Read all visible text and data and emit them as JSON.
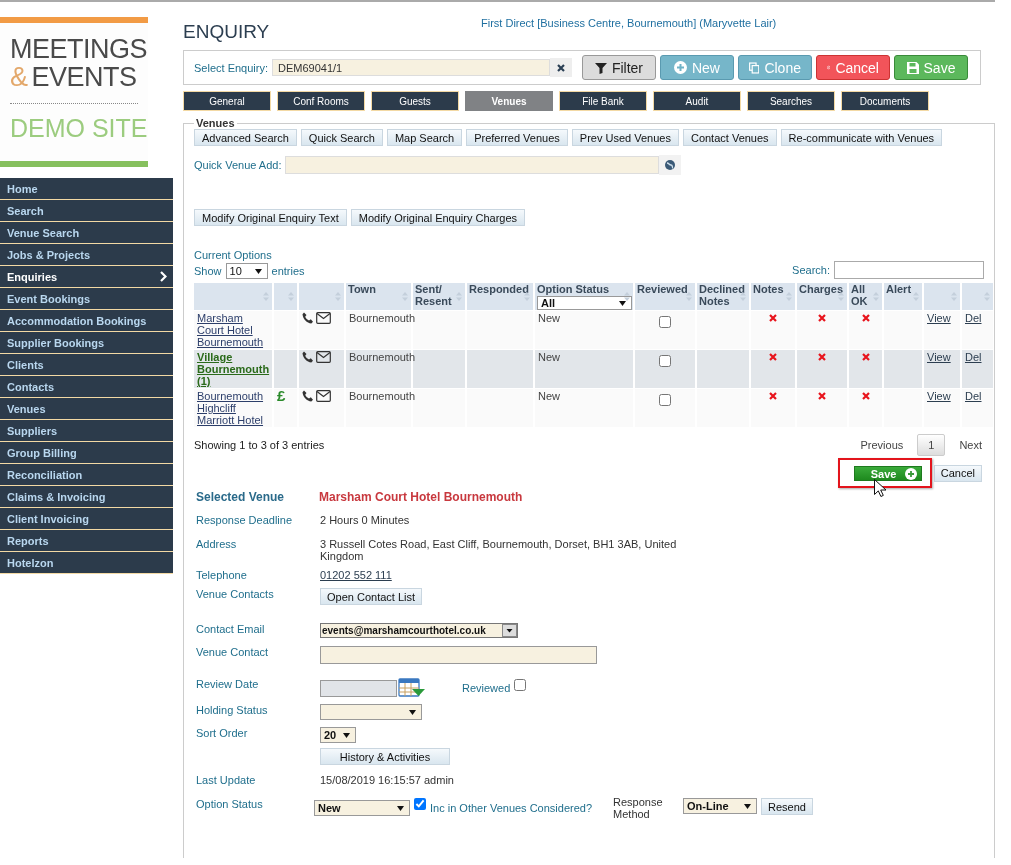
{
  "logo": {
    "line_1": "MEETINGS",
    "ampersand": "&",
    "line_2": "EVENTS",
    "line_3": "DEMO SITE"
  },
  "sidebar": {
    "items": [
      {
        "label": "Home",
        "selected": false
      },
      {
        "label": "Search",
        "selected": false
      },
      {
        "label": "Venue Search",
        "selected": false
      },
      {
        "label": "Jobs & Projects",
        "selected": false
      },
      {
        "label": "Enquiries",
        "selected": true
      },
      {
        "label": "Event Bookings",
        "selected": false
      },
      {
        "label": "Accommodation Bookings",
        "selected": false
      },
      {
        "label": "Supplier Bookings",
        "selected": false
      },
      {
        "label": "Clients",
        "selected": false
      },
      {
        "label": "Contacts",
        "selected": false
      },
      {
        "label": "Venues",
        "selected": false
      },
      {
        "label": "Suppliers",
        "selected": false
      },
      {
        "label": "Group Billing",
        "selected": false
      },
      {
        "label": "Reconciliation",
        "selected": false
      },
      {
        "label": "Claims & Invoicing",
        "selected": false
      },
      {
        "label": "Client Invoicing",
        "selected": false
      },
      {
        "label": "Reports",
        "selected": false
      },
      {
        "label": "Hotelzon",
        "selected": false
      }
    ]
  },
  "page_title": "ENQUIRY",
  "context": "First Direct [Business Centre, Bournemouth] (Maryvette Lair)",
  "enquiry_bar": {
    "label": "Select Enquiry:",
    "value": "DEM69041/1",
    "buttons": [
      {
        "label": "Filter",
        "kind": "filter"
      },
      {
        "label": "New",
        "kind": "new"
      },
      {
        "label": "Clone",
        "kind": "clone"
      },
      {
        "label": "Cancel",
        "kind": "cancel"
      },
      {
        "label": "Save",
        "kind": "save"
      }
    ]
  },
  "tabs": [
    {
      "label": "General",
      "selected": false
    },
    {
      "label": "Conf Rooms",
      "selected": false
    },
    {
      "label": "Guests",
      "selected": false
    },
    {
      "label": "Venues",
      "selected": true
    },
    {
      "label": "File Bank",
      "selected": false
    },
    {
      "label": "Audit",
      "selected": false
    },
    {
      "label": "Searches",
      "selected": false
    },
    {
      "label": "Documents",
      "selected": false
    }
  ],
  "venues": {
    "legend": "Venues",
    "search_buttons": [
      "Advanced Search",
      "Quick Search",
      "Map Search",
      "Preferred Venues",
      "Prev Used Venues",
      "Contact Venues",
      "Re-communicate with Venues"
    ],
    "quick_add_label": "Quick Venue Add:",
    "modify_buttons": [
      "Modify Original Enquiry Text",
      "Modify Original Enquiry Charges"
    ],
    "options": {
      "title": "Current Options",
      "show": "Show",
      "page_length": "10",
      "entries": "entries",
      "search_label": "Search:",
      "columns": [
        {},
        {},
        {},
        {
          "label": "Town"
        },
        {
          "label": "Sent/ Resent"
        },
        {
          "label": "Responded"
        },
        {
          "label": "Option Status",
          "filter": "All"
        },
        {
          "label": "Reviewed"
        },
        {
          "label": "Declined Notes"
        },
        {
          "label": "Notes"
        },
        {
          "label": "Charges"
        },
        {
          "label": "All OK"
        },
        {
          "label": "Alert"
        },
        {},
        {}
      ],
      "rows": [
        {
          "venue": "Marsham Court Hotel Bournemouth",
          "highlighted": false,
          "town": "Bournemouth",
          "status": "New",
          "reviewed": false,
          "notes_ok": false,
          "charges_ok": false,
          "all_ok": false,
          "view": "View",
          "delete": "Del"
        },
        {
          "venue": "Village Bournemouth (1)",
          "highlighted": true,
          "town": "Bournemouth",
          "status": "New",
          "reviewed": false,
          "notes_ok": false,
          "charges_ok": false,
          "all_ok": false,
          "view": "View",
          "delete": "Del"
        },
        {
          "venue": "Bournemouth Highcliff Marriott Hotel",
          "highlighted": false,
          "price_mark": "£",
          "town": "Bournemouth",
          "status": "New",
          "reviewed": false,
          "notes_ok": false,
          "charges_ok": false,
          "all_ok": false,
          "view": "View",
          "delete": "Del"
        }
      ],
      "info": "Showing 1 to 3 of 3 entries",
      "previous": "Previous",
      "page": "1",
      "next": "Next"
    },
    "actions": {
      "save": "Save",
      "cancel": "Cancel"
    },
    "selected_venue": {
      "label": "Selected Venue",
      "value": "Marsham Court Hotel Bournemouth"
    },
    "details": [
      {
        "kind": "text",
        "label": "Response Deadline",
        "value": "2 Hours 0 Minutes"
      },
      {
        "kind": "text",
        "label": "Address",
        "value": "3 Russell Cotes Road, East Cliff, Bournemouth, Dorset, BH1 3AB, United Kingdom"
      },
      {
        "kind": "link",
        "label": "Telephone",
        "value": "01202 552 111"
      },
      {
        "kind": "button",
        "label": "Venue Contacts",
        "value": "Open Contact List"
      },
      {
        "kind": "combo",
        "label": "Contact Email",
        "value": "events@marshamcourthotel.co.uk"
      },
      {
        "kind": "input",
        "label": "Venue Contact"
      },
      {
        "kind": "date",
        "label": "Review Date",
        "check_label": "Reviewed",
        "checked": false
      },
      {
        "kind": "select",
        "label": "Holding Status"
      },
      {
        "kind": "select",
        "label": "Sort Order",
        "value": "20"
      },
      {
        "kind": "button",
        "value": "History & Activities"
      },
      {
        "kind": "text",
        "label": "Last Update",
        "value": "15/08/2019 16:15:57 admin"
      },
      {
        "kind": "status",
        "label": "Option Status",
        "value": "New",
        "check_label": "Inc in Other Venues Considered?",
        "checked": true,
        "method_label": "Response Method",
        "method": "On-Line",
        "resend": "Resend"
      }
    ]
  }
}
